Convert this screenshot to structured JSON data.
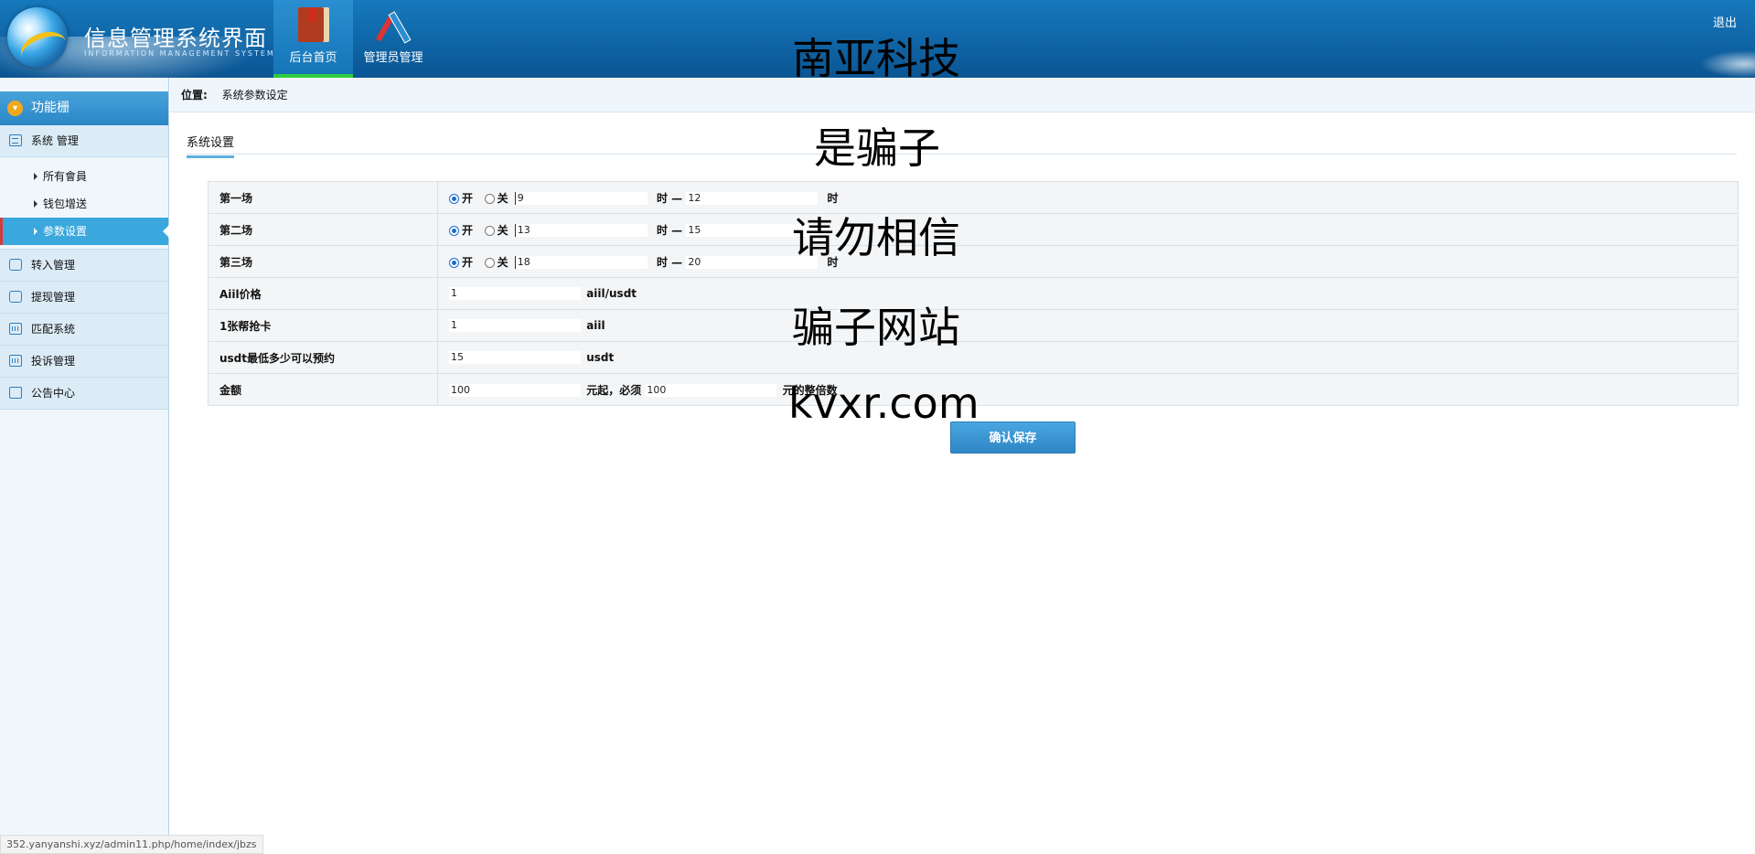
{
  "header": {
    "logo_title": "信息管理系统界面",
    "logo_subtitle": "INFORMATION MANAGEMENT SYSTEM GUI",
    "tabs": [
      {
        "label": "后台首页",
        "icon": "book-icon",
        "active": true
      },
      {
        "label": "管理员管理",
        "icon": "tools-icon",
        "active": false
      }
    ],
    "logout": "退出"
  },
  "sidebar": {
    "title": "功能栅",
    "groups": [
      {
        "label": "系统 管理",
        "icon": "list-icon"
      },
      {
        "label": "转入管理",
        "icon": "chat-icon"
      },
      {
        "label": "提现管理",
        "icon": "chat-icon"
      },
      {
        "label": "匹配系统",
        "icon": "calendar-icon"
      },
      {
        "label": "投诉管理",
        "icon": "calendar-icon"
      },
      {
        "label": "公告中心",
        "icon": "edit-icon"
      }
    ],
    "sub_items": [
      {
        "label": "所有會員",
        "active": false
      },
      {
        "label": "钱包增送",
        "active": false
      },
      {
        "label": "参数设置",
        "active": true
      }
    ]
  },
  "breadcrumb": {
    "label": "位置:",
    "current": "系统参数设定"
  },
  "tab_title": "系统设置",
  "sessions": [
    {
      "label": "第一场",
      "on": "开",
      "off": "关",
      "start": "9",
      "hour1": "时 —",
      "end": "12",
      "hour2": "时",
      "selected": "on"
    },
    {
      "label": "第二场",
      "on": "开",
      "off": "关",
      "start": "13",
      "hour1": "时 —",
      "end": "15",
      "hour2": "",
      "selected": "on"
    },
    {
      "label": "第三场",
      "on": "开",
      "off": "关",
      "start": "18",
      "hour1": "时 —",
      "end": "20",
      "hour2": "时",
      "selected": "on"
    }
  ],
  "params": {
    "aiil_price": {
      "label": "Aiil价格",
      "value": "1",
      "unit": "aiil/usdt"
    },
    "card": {
      "label": "1张帮抢卡",
      "value": "1",
      "unit": "aiil"
    },
    "usdt_min": {
      "label": "usdt最低多少可以预约",
      "value": "15",
      "unit": "usdt"
    },
    "amount": {
      "label": "金额",
      "value": "100",
      "mid": "元起，必须",
      "value2": "100",
      "unit": "元的整倍数"
    }
  },
  "save_button": "确认保存",
  "watermarks": [
    "南亚科技",
    "是骗子",
    "请勿相信",
    "骗子网站",
    "kvxr.com"
  ],
  "status_url": "352.yanyanshi.xyz/admin11.php/home/index/jbzs"
}
